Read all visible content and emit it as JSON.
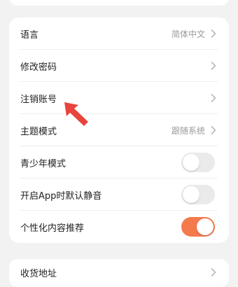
{
  "settings": {
    "items": [
      {
        "label": "语言",
        "value": "简体中文"
      },
      {
        "label": "修改密码",
        "value": ""
      },
      {
        "label": "注销账号",
        "value": ""
      },
      {
        "label": "主题模式",
        "value": "跟随系统"
      },
      {
        "label": "青少年模式",
        "toggle": false
      },
      {
        "label": "开启App时默认静音",
        "toggle": false
      },
      {
        "label": "个性化内容推荐",
        "toggle": true
      }
    ]
  },
  "bottom": {
    "label": "收货地址"
  },
  "colors": {
    "accent": "#f47a4c",
    "annotation_arrow": "#e8453c",
    "background": "#f2f2f2"
  }
}
